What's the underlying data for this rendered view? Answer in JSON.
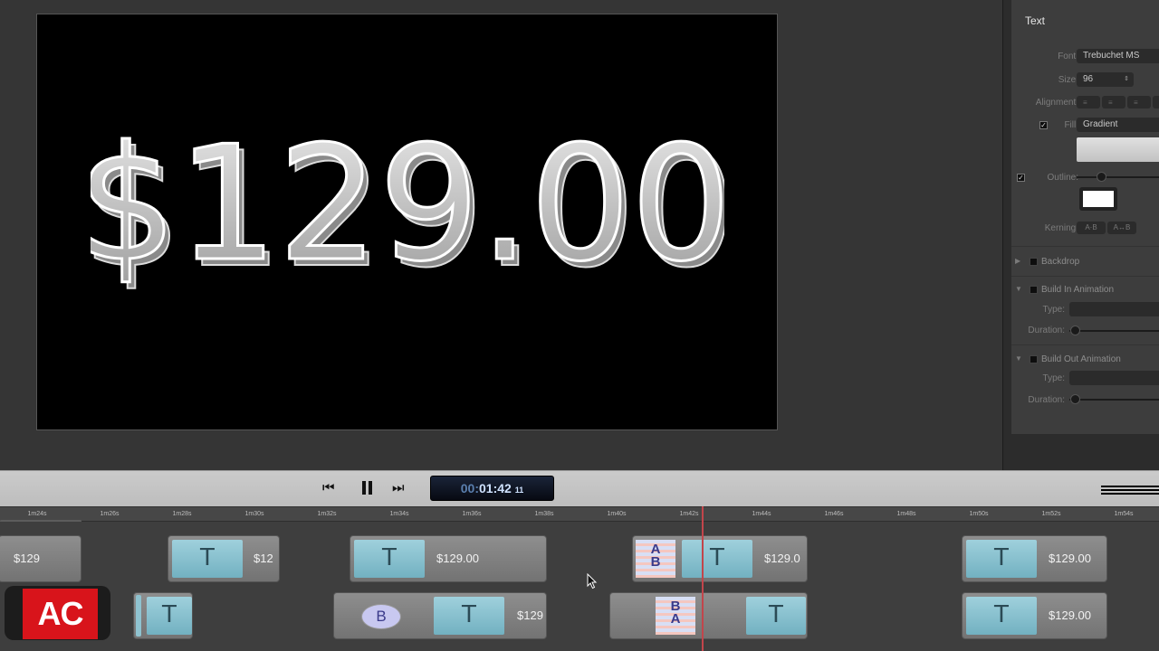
{
  "canvas": {
    "text": "$129.00"
  },
  "inspector": {
    "title": "Text",
    "font_label": "Font:",
    "font_value": "Trebuchet MS",
    "size_label": "Size:",
    "size_value": "96",
    "alignment_label": "Alignment:",
    "fill_label": "Fill:",
    "fill_value": "Gradient",
    "outline_label": "Outline:",
    "kerning_label": "Kerning:",
    "kerning_btn1": "A·B",
    "kerning_btn2": "A↔B",
    "backdrop_label": "Backdrop",
    "build_in_label": "Build In Animation",
    "build_out_label": "Build Out Animation",
    "type_label": "Type:",
    "duration_label": "Duration:"
  },
  "transport": {
    "timecode_dim": "00:",
    "timecode_main": "01:42",
    "timecode_frames": "11"
  },
  "ruler": {
    "ticks": [
      "1m24s",
      "1m26s",
      "1m28s",
      "1m30s",
      "1m32s",
      "1m34s",
      "1m36s",
      "1m38s",
      "1m40s",
      "1m42s",
      "1m44s",
      "1m46s",
      "1m48s",
      "1m50s",
      "1m52s",
      "1m54s"
    ]
  },
  "timeline": {
    "track1": {
      "clip1_label": "$129",
      "clip2_label": "$12",
      "clip3_label": "$129.00",
      "clip4_label": "$129.0",
      "clip5_label": "$129.00"
    },
    "track2": {
      "clip3_label": "$129",
      "clip5_label": "$129.00"
    },
    "title_thumb_glyph": "T",
    "b_glyph": "B",
    "ab_glyph_a": "A",
    "ab_glyph_b": "B"
  },
  "badge": {
    "text": "AC"
  }
}
